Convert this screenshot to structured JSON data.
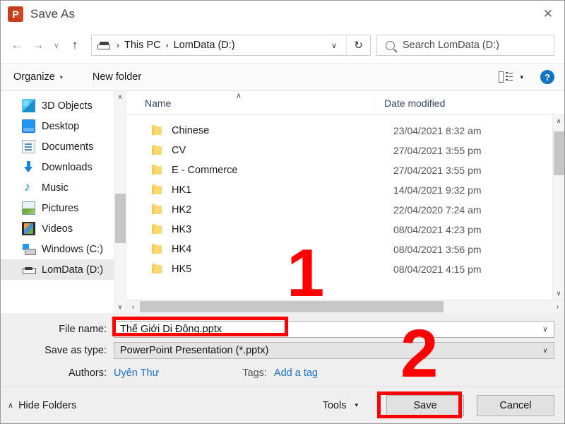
{
  "window": {
    "app_icon": "powerpoint-icon",
    "app_initial": "P",
    "title": "Save As",
    "close_label": "✕"
  },
  "nav": {
    "back": "←",
    "forward": "→",
    "recent_caret": "∨",
    "up": "↑",
    "breadcrumb": [
      "This PC",
      "LomData (D:)"
    ],
    "separator": "›",
    "address_caret": "∨",
    "refresh": "↻",
    "drive_icon": "drive-icon"
  },
  "search": {
    "icon": "search-icon",
    "placeholder": "Search LomData (D:)"
  },
  "command_bar": {
    "organize": "Organize",
    "organize_caret": "▾",
    "new_folder": "New folder",
    "view_icon": "view-layout-icon",
    "view_caret": "▾",
    "help": "?"
  },
  "nav_pane": {
    "items": [
      {
        "label": "3D Objects",
        "icon": "3d-objects-icon",
        "selected": false
      },
      {
        "label": "Desktop",
        "icon": "desktop-icon",
        "selected": false
      },
      {
        "label": "Documents",
        "icon": "documents-icon",
        "selected": false
      },
      {
        "label": "Downloads",
        "icon": "downloads-icon",
        "selected": false
      },
      {
        "label": "Music",
        "icon": "music-icon",
        "selected": false
      },
      {
        "label": "Pictures",
        "icon": "pictures-icon",
        "selected": false
      },
      {
        "label": "Videos",
        "icon": "videos-icon",
        "selected": false
      },
      {
        "label": "Windows (C:)",
        "icon": "windows-drive-icon",
        "selected": false
      },
      {
        "label": "LomData (D:)",
        "icon": "drive-icon",
        "selected": true
      }
    ],
    "scroll_up": "∧",
    "scroll_down": "∨"
  },
  "file_list": {
    "columns": [
      "Name",
      "Date modified"
    ],
    "sort_indicator": "∧",
    "rows": [
      {
        "name": "Chinese",
        "date": "23/04/2021 8:32 am"
      },
      {
        "name": "CV",
        "date": "27/04/2021 3:55 pm"
      },
      {
        "name": "E - Commerce",
        "date": "27/04/2021 3:55 pm"
      },
      {
        "name": "HK1",
        "date": "14/04/2021 9:32 pm"
      },
      {
        "name": "HK2",
        "date": "22/04/2020 7:24 am"
      },
      {
        "name": "HK3",
        "date": "08/04/2021 4:23 pm"
      },
      {
        "name": "HK4",
        "date": "08/04/2021 3:56 pm"
      },
      {
        "name": "HK5",
        "date": "08/04/2021 4:15 pm"
      }
    ],
    "scroll_up": "∧",
    "scroll_down": "∨",
    "scroll_left": "‹",
    "scroll_right": "›"
  },
  "form": {
    "file_name_label": "File name:",
    "file_name_value": "Thế Giới Di Động.pptx",
    "save_as_type_label": "Save as type:",
    "save_as_type_value": "PowerPoint Presentation (*.pptx)",
    "dropdown_caret": "∨",
    "authors_label": "Authors:",
    "authors_value": "Uyên Thư",
    "tags_label": "Tags:",
    "tags_value": "Add a tag"
  },
  "footer": {
    "hide_folders": "Hide Folders",
    "hide_folders_chevron": "∧",
    "tools": "Tools",
    "tools_caret": "▾",
    "save": "Save",
    "cancel": "Cancel"
  },
  "annotations": {
    "step_one": "1",
    "step_two": "2",
    "highlight_color": "#ff0000"
  }
}
